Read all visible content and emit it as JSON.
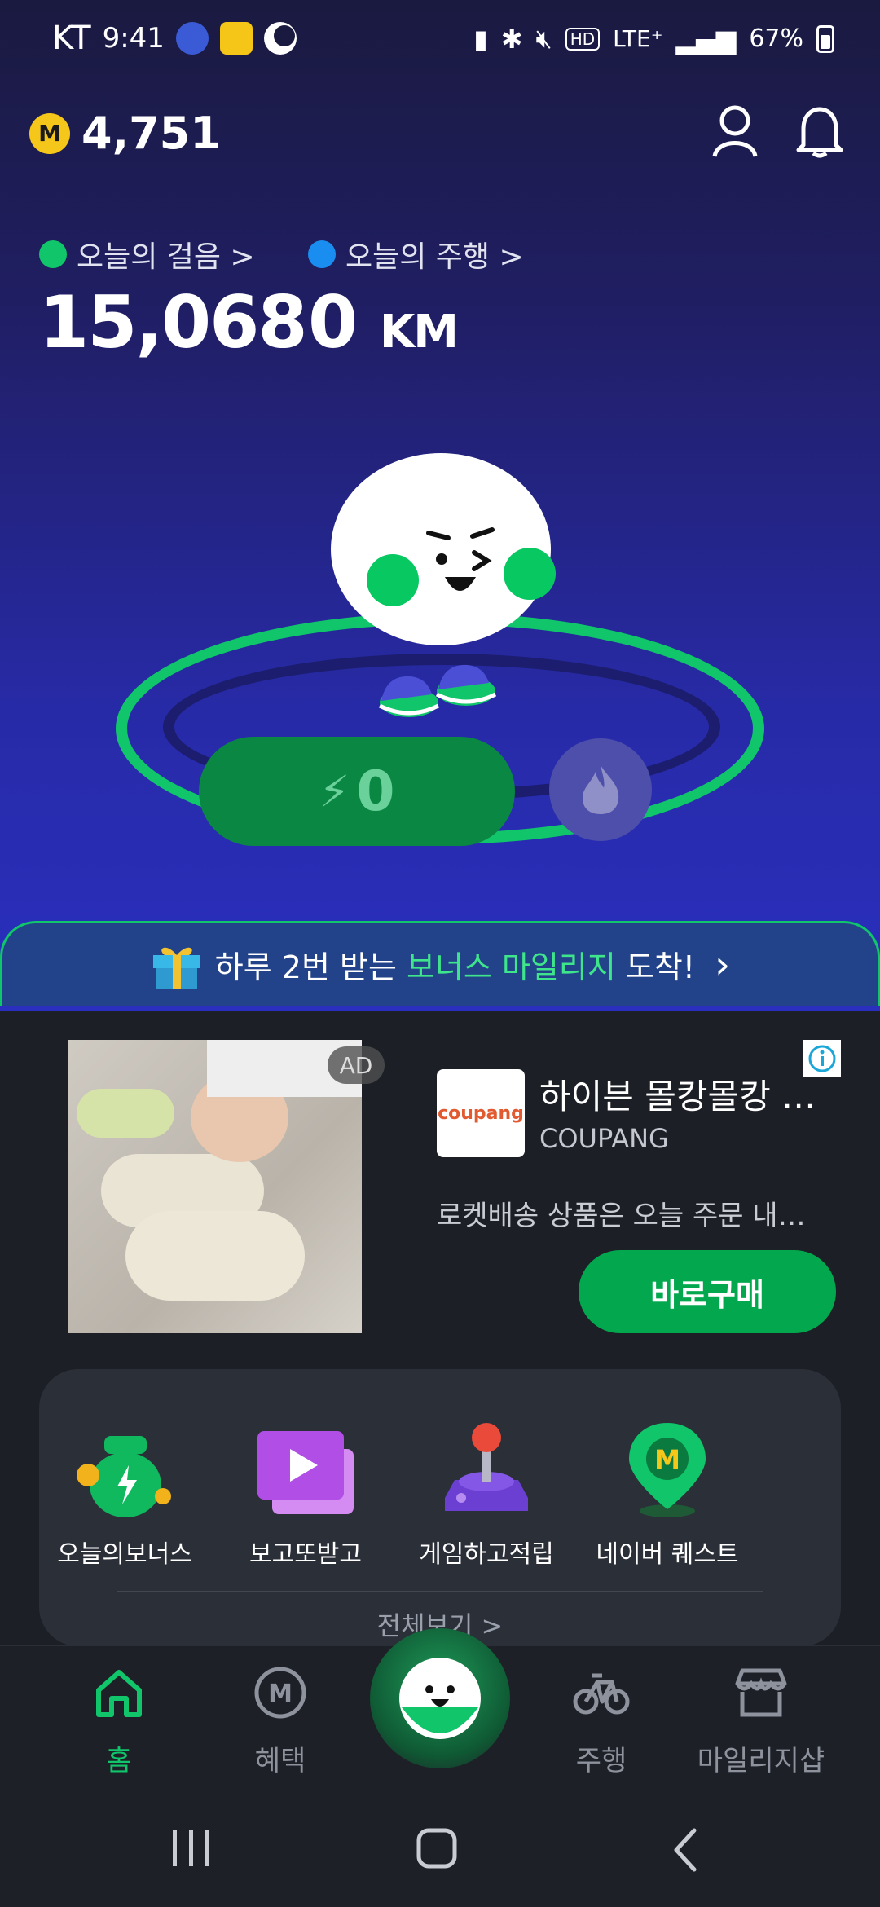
{
  "status_bar": {
    "carrier": "KT",
    "time": "9:41",
    "network": "LTE⁺",
    "battery": "67%"
  },
  "header": {
    "points": "4,751",
    "coin_symbol": "M"
  },
  "stats": {
    "steps": {
      "label": "오늘의 걸음 >",
      "value": "15,068"
    },
    "ride": {
      "label": "오늘의 주행 >",
      "value": "0",
      "unit": "KM"
    }
  },
  "charge": {
    "value": "0",
    "bolt": "⚡"
  },
  "banner": {
    "text_before": "하루 2번 받는 ",
    "highlight": "보너스 마일리지",
    "text_after": " 도착!",
    "arrow": "›"
  },
  "ad": {
    "tag": "AD",
    "logo_text": "coupang",
    "title": "하이븐 몰캉몰캉 …",
    "advertiser": "COUPANG",
    "description": "로켓배송 상품은 오늘 주문 내…",
    "cta": "바로구매"
  },
  "menu": {
    "items": [
      {
        "label": "오늘의보너스"
      },
      {
        "label": "보고또받고"
      },
      {
        "label": "게임하고적립"
      },
      {
        "label": "네이버 퀘스트"
      }
    ],
    "see_all": "전체보기 >"
  },
  "bottom_nav": {
    "items": [
      {
        "label": "홈"
      },
      {
        "label": "혜택"
      },
      {
        "label": "주행"
      },
      {
        "label": "마일리지샵"
      }
    ]
  },
  "colors": {
    "accent": "#10c56a",
    "hero_bg": "#272aa6",
    "coin": "#f6c71b"
  }
}
